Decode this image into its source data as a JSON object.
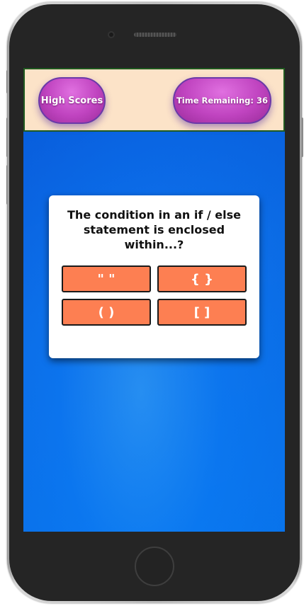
{
  "header": {
    "high_scores_label": "High Scores",
    "time_remaining_label": "Time Remaining: 36"
  },
  "quiz": {
    "question": "The condition in an if / else statement is enclosed within...?",
    "answers": [
      {
        "label": "\" \""
      },
      {
        "label": "{ }"
      },
      {
        "label": "( )"
      },
      {
        "label": "[ ]"
      }
    ]
  },
  "colors": {
    "header_bg": "#fce3c8",
    "pill_purple": "#c044c0",
    "screen_blue": "#0d72ec",
    "answer_orange": "#fd7f52",
    "card_bg": "#ffffff"
  },
  "icons": {
    "camera": "camera-icon",
    "speaker": "speaker-grille-icon",
    "home": "home-button-icon"
  }
}
